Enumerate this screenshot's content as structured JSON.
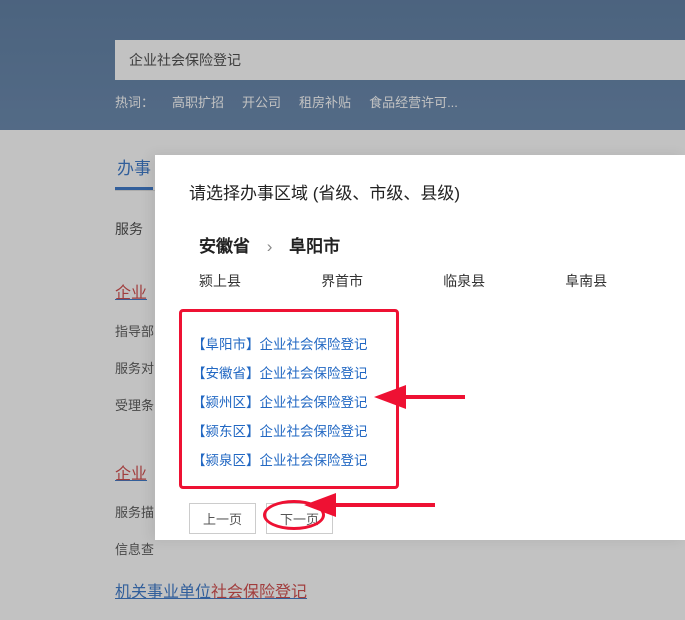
{
  "search": {
    "value": "企业社会保险登记"
  },
  "hotwords": {
    "label": "热词：",
    "items": [
      "高职扩招",
      "开公司",
      "租房补贴",
      "食品经营许可..."
    ]
  },
  "tabs": {
    "active": "办事"
  },
  "filter": {
    "label": "服务"
  },
  "results_bg": {
    "title_prefix": "企业",
    "meta1": "指导部",
    "meta2": "服务对",
    "meta3": "受理条",
    "title2_prefix": "企业",
    "meta4": "服务描",
    "meta5": "信息查"
  },
  "bottom_link": {
    "part1": "机关事业单位",
    "part2": "社会保险登记"
  },
  "modal": {
    "title": "请选择办事区域 (省级、市级、县级)",
    "breadcrumb": {
      "province": "安徽省",
      "sep": "›",
      "city": "阜阳市"
    },
    "counties": [
      "颍上县",
      "界首市",
      "临泉县",
      "阜南县"
    ],
    "items": [
      {
        "region": "【阜阳市】",
        "name": "企业社会保险登记"
      },
      {
        "region": "【安徽省】",
        "name": "企业社会保险登记"
      },
      {
        "region": "【颍州区】",
        "name": "企业社会保险登记"
      },
      {
        "region": "【颍东区】",
        "name": "企业社会保险登记"
      },
      {
        "region": "【颍泉区】",
        "name": "企业社会保险登记"
      }
    ],
    "pager": {
      "prev": "上一页",
      "next": "下一页"
    }
  }
}
